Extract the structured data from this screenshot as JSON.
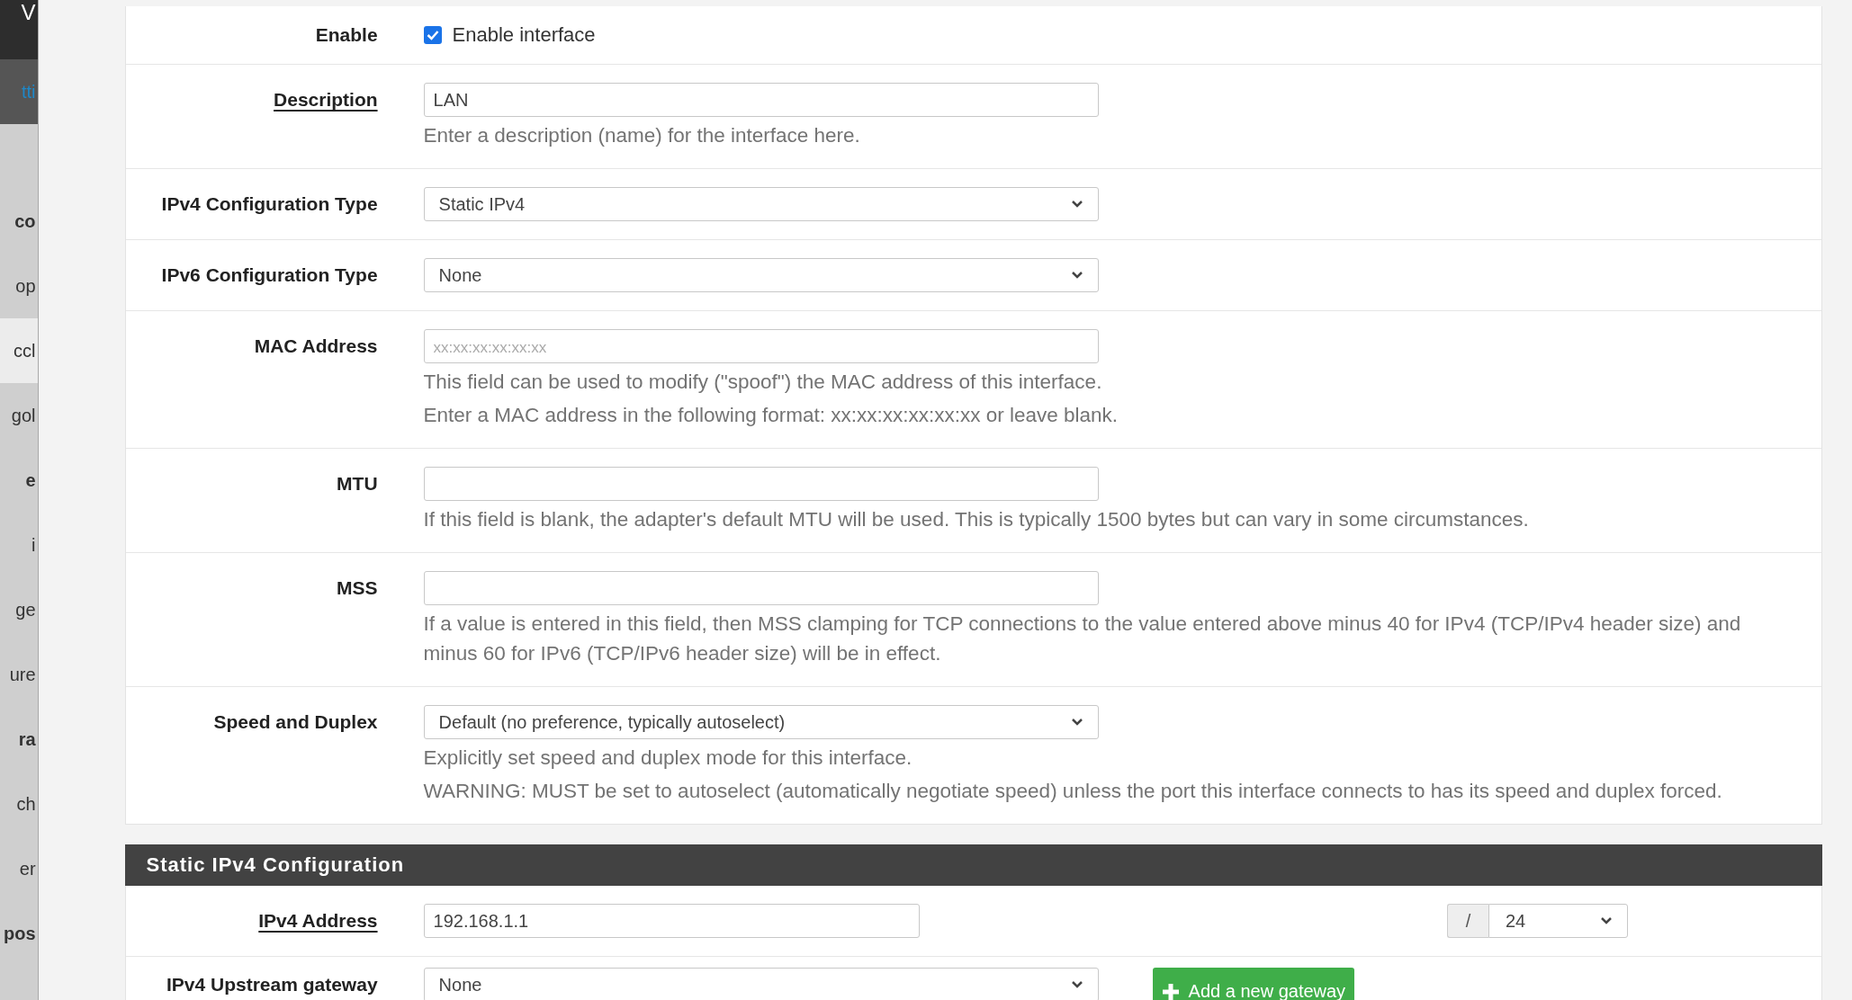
{
  "sidebar": {
    "items": [
      {
        "label": "V",
        "kind": "dark",
        "bold": false
      },
      {
        "label": "tti",
        "kind": "active",
        "bold": false
      },
      {
        "label": "co",
        "kind": "plain",
        "bold": true
      },
      {
        "label": "op",
        "kind": "plain",
        "bold": false
      },
      {
        "label": "ccl",
        "kind": "hover",
        "bold": false
      },
      {
        "label": "gol",
        "kind": "plain",
        "bold": false
      },
      {
        "label": "e",
        "kind": "plain",
        "bold": true
      },
      {
        "label": "i",
        "kind": "plain",
        "bold": false
      },
      {
        "label": "ge",
        "kind": "plain",
        "bold": false
      },
      {
        "label": "ure",
        "kind": "plain",
        "bold": false
      },
      {
        "label": "ra",
        "kind": "plain",
        "bold": true
      },
      {
        "label": "ch",
        "kind": "plain",
        "bold": false
      },
      {
        "label": "er",
        "kind": "plain",
        "bold": false
      },
      {
        "label": "pos",
        "kind": "plain",
        "bold": true
      }
    ]
  },
  "general": {
    "rows": [
      {
        "label": "Enable",
        "label_link": false,
        "kind": "checkbox",
        "text": "Enable interface",
        "checked": true
      },
      {
        "label": "Description",
        "label_link": true,
        "kind": "text",
        "value": "LAN",
        "help": [
          "Enter a description (name) for the interface here."
        ]
      },
      {
        "label": "IPv4 Configuration Type",
        "label_link": false,
        "kind": "select",
        "value": "Static IPv4"
      },
      {
        "label": "IPv6 Configuration Type",
        "label_link": false,
        "kind": "select",
        "value": "None"
      },
      {
        "label": "MAC Address",
        "label_link": false,
        "kind": "text",
        "placeholder": "xx:xx:xx:xx:xx:xx",
        "help": [
          "This field can be used to modify (\"spoof\") the MAC address of this interface.",
          "Enter a MAC address in the following format: xx:xx:xx:xx:xx:xx or leave blank."
        ]
      },
      {
        "label": "MTU",
        "label_link": false,
        "kind": "text",
        "help": [
          "If this field is blank, the adapter's default MTU will be used. This is typically 1500 bytes but can vary in some circumstances."
        ]
      },
      {
        "label": "MSS",
        "label_link": false,
        "kind": "text",
        "help": [
          "If a value is entered in this field, then MSS clamping for TCP connections to the value entered above minus 40 for IPv4 (TCP/IPv4 header size) and minus 60 for IPv6 (TCP/IPv6 header size) will be in effect."
        ]
      },
      {
        "label": "Speed and Duplex",
        "label_link": false,
        "kind": "select",
        "value": "Default (no preference, typically autoselect)",
        "help": [
          "Explicitly set speed and duplex mode for this interface.",
          "WARNING: MUST be set to autoselect (automatically negotiate speed) unless the port this interface connects to has its speed and duplex forced."
        ]
      }
    ]
  },
  "static_ipv4": {
    "title": "Static IPv4 Configuration",
    "rows": [
      {
        "label": "IPv4 Address",
        "label_link": true,
        "kind": "cidr",
        "value": "192.168.1.1",
        "separator": "/",
        "mask": "24"
      },
      {
        "label": "IPv4 Upstream gateway",
        "label_link": false,
        "kind": "select_button",
        "value": "None",
        "button": "Add a new gateway"
      }
    ]
  }
}
